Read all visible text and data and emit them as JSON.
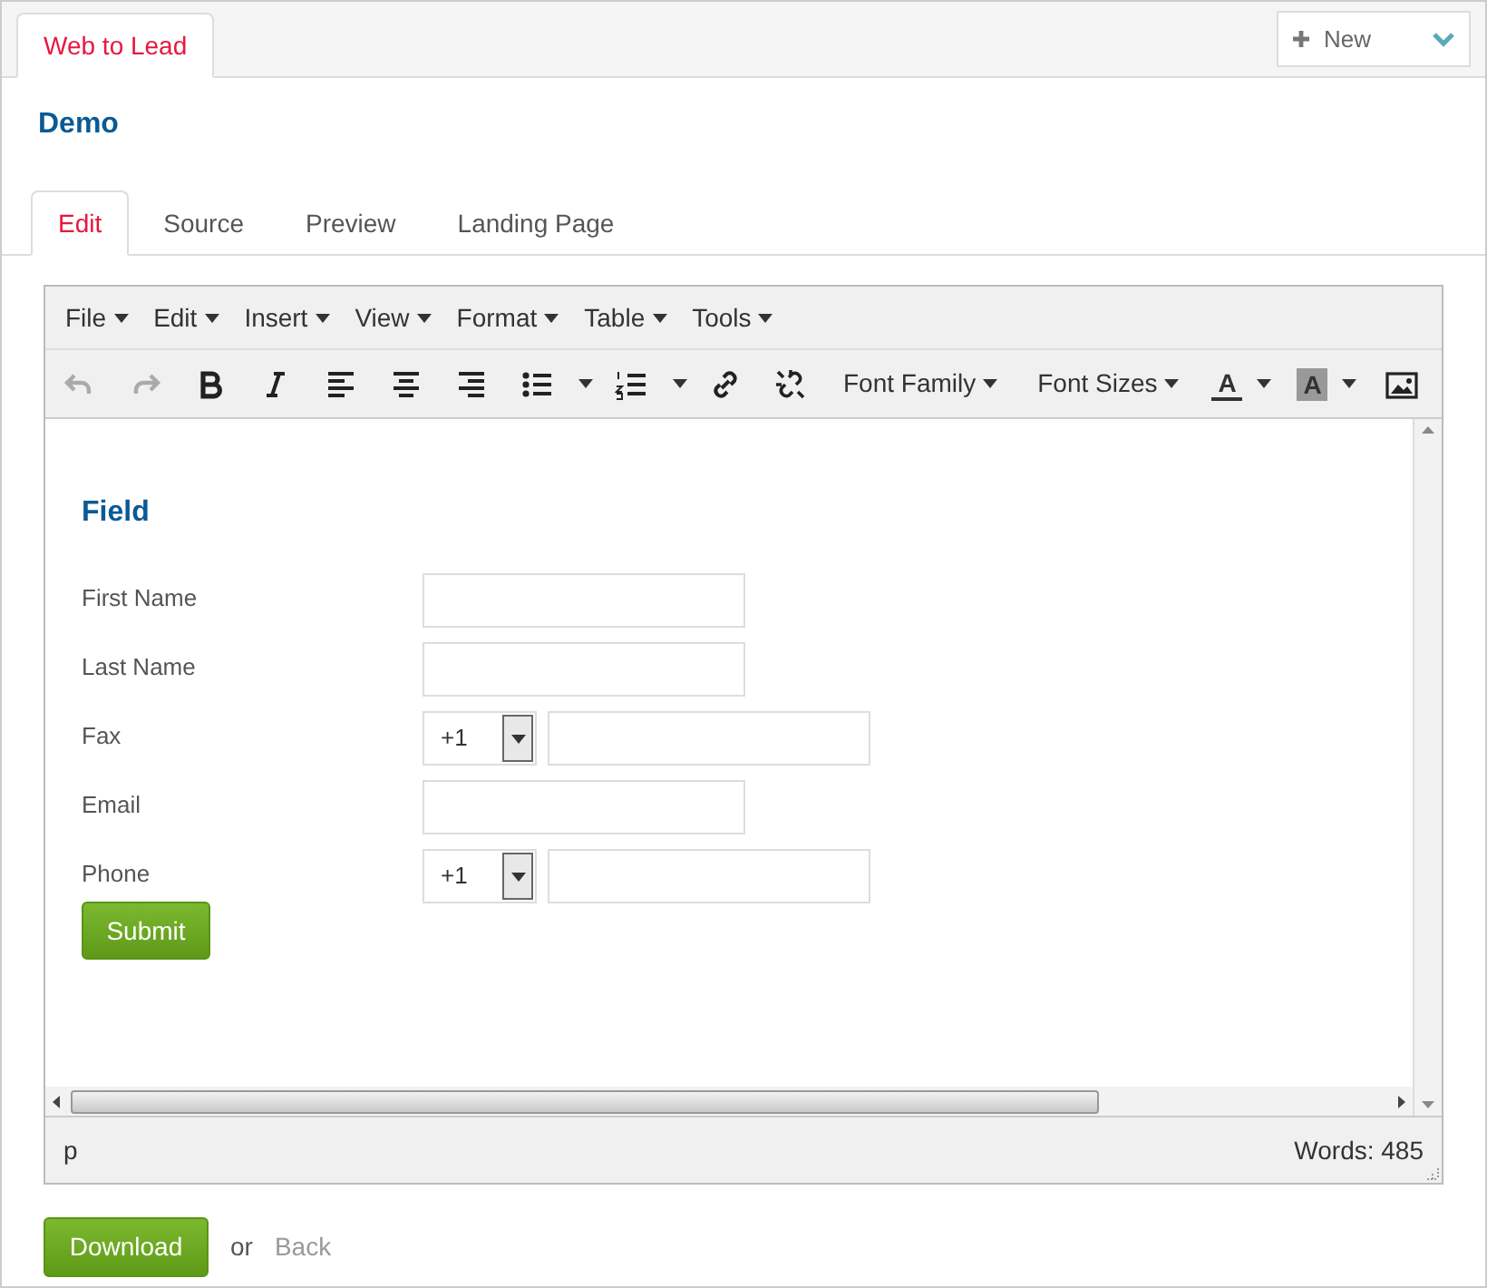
{
  "top_tabs": [
    {
      "label": "Web to Lead",
      "selected": true
    }
  ],
  "new_button": {
    "label": "New"
  },
  "title": "Demo",
  "tabs": [
    {
      "label": "Edit",
      "selected": true
    },
    {
      "label": "Source",
      "selected": false
    },
    {
      "label": "Preview",
      "selected": false
    },
    {
      "label": "Landing Page",
      "selected": false
    }
  ],
  "editor": {
    "menus": [
      "File",
      "Edit",
      "Insert",
      "View",
      "Format",
      "Table",
      "Tools"
    ],
    "toolbar": [
      {
        "kind": "button",
        "disabled": true
      },
      {
        "kind": "button",
        "disabled": true
      },
      {
        "kind": "button",
        "disabled": false
      },
      {
        "kind": "button",
        "disabled": false
      },
      {
        "kind": "button",
        "disabled": false
      },
      {
        "kind": "button",
        "disabled": false
      },
      {
        "kind": "button",
        "disabled": false
      },
      {
        "kind": "split",
        "disabled": false
      },
      {
        "kind": "split",
        "disabled": false
      },
      {
        "kind": "button",
        "disabled": false
      },
      {
        "kind": "button",
        "disabled": false
      },
      {
        "kind": "dropdown",
        "label": "Font Family"
      },
      {
        "kind": "dropdown",
        "label": "Font Sizes"
      },
      {
        "kind": "color",
        "label": "A",
        "shaded": false
      },
      {
        "kind": "color",
        "label": "A",
        "shaded": true
      },
      {
        "kind": "button",
        "disabled": false
      }
    ],
    "form": {
      "heading": "Field",
      "fields": [
        {
          "kind": "text",
          "label": "First Name"
        },
        {
          "kind": "text",
          "label": "Last Name"
        },
        {
          "kind": "phone",
          "label": "Fax",
          "code": "+1"
        },
        {
          "kind": "text",
          "label": "Email"
        },
        {
          "kind": "phone",
          "label": "Phone",
          "code": "+1"
        }
      ],
      "submit": "Submit"
    },
    "path": "p",
    "word_count": "Words: 485"
  },
  "footer": {
    "download": "Download",
    "or": "or",
    "back": "Back"
  }
}
